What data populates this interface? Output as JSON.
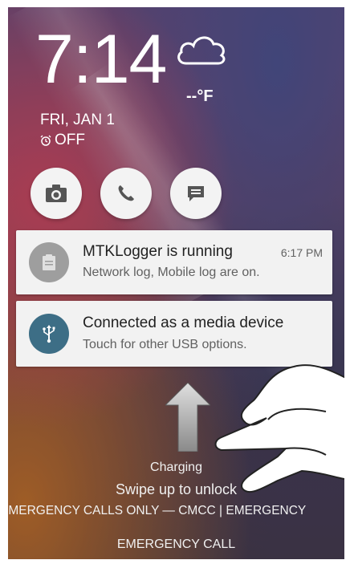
{
  "lockscreen": {
    "time": "7:14",
    "temperature": "--°F",
    "date": "FRI, JAN 1",
    "alarm": "OFF",
    "weather_icon": "cloud-icon"
  },
  "quick_actions": [
    {
      "icon": "camera-icon"
    },
    {
      "icon": "phone-icon"
    },
    {
      "icon": "message-icon"
    }
  ],
  "notifications": [
    {
      "title": "MTKLogger is running",
      "time": "6:17 PM",
      "subtitle": "Network log, Mobile log are on.",
      "icon": "clipboard-icon",
      "badge_color": "#9e9e9e"
    },
    {
      "title": "Connected as a media device",
      "subtitle": "Touch for other USB options.",
      "icon": "usb-icon",
      "badge_color": "#3d6e86"
    }
  ],
  "status": {
    "charging": "Charging",
    "swipe_hint": "Swipe up to unlock",
    "carrier": "EMERGENCY CALLS ONLY — CMCC | EMERGENCY"
  },
  "emergency_call": "EMERGENCY CALL"
}
